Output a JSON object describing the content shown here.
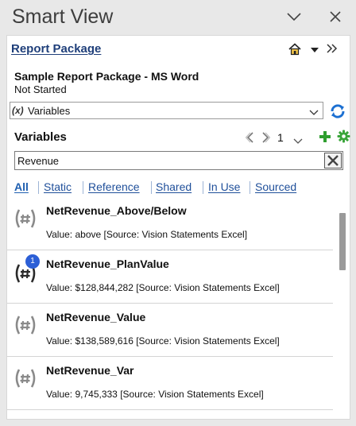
{
  "app": {
    "title": "Smart View"
  },
  "window": {
    "minimize_icon": "chevron-down-icon",
    "close_icon": "close-icon"
  },
  "header": {
    "report_package_link": "Report Package",
    "icons": [
      "home-icon",
      "dropdown-arrow-icon",
      "double-chevron-right-icon"
    ]
  },
  "package": {
    "title": "Sample Report Package - MS Word",
    "status": "Not Started"
  },
  "view_select": {
    "icon_text": "(x)",
    "selected": "Variables"
  },
  "section": {
    "title": "Variables"
  },
  "pager": {
    "page": "1"
  },
  "search": {
    "value": "Revenue",
    "placeholder": ""
  },
  "filters": [
    {
      "label": "All",
      "active": true
    },
    {
      "label": "Static",
      "active": false
    },
    {
      "label": "Reference",
      "active": false
    },
    {
      "label": "Shared",
      "active": false
    },
    {
      "label": "In Use",
      "active": false
    },
    {
      "label": "Sourced",
      "active": false
    }
  ],
  "variables": [
    {
      "name": "NetRevenue_Above/Below",
      "value": "Value: above [Source: Vision Statements Excel]",
      "badge": ""
    },
    {
      "name": "NetRevenue_PlanValue",
      "value": "Value:  $128,844,282  [Source: Vision Statements Excel]",
      "badge": "1"
    },
    {
      "name": "NetRevenue_Value",
      "value": "Value:  $138,589,616  [Source: Vision Statements Excel]",
      "badge": ""
    },
    {
      "name": "NetRevenue_Var",
      "value": "Value:  9,745,333  [Source: Vision Statements Excel]",
      "badge": ""
    }
  ],
  "colors": {
    "link": "#1f3f7a",
    "filter_link": "#1f4f9a",
    "badge": "#2c5fd6",
    "add_icon": "#2f9e2f",
    "refresh_icon": "#1b6fd1"
  }
}
